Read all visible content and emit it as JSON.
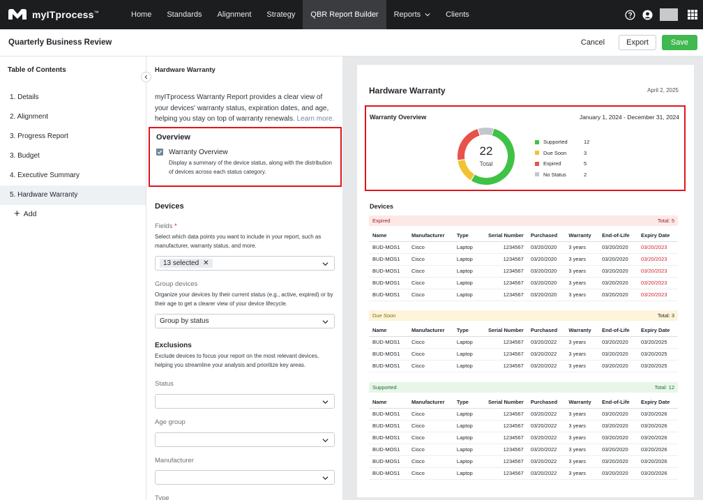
{
  "nav": {
    "brand": "myITprocess",
    "items": [
      {
        "label": "Home",
        "active": false
      },
      {
        "label": "Standards",
        "active": false
      },
      {
        "label": "Alignment",
        "active": false
      },
      {
        "label": "Strategy",
        "active": false
      },
      {
        "label": "QBR Report Builder",
        "active": true
      },
      {
        "label": "Reports",
        "active": false,
        "dropdown": true
      },
      {
        "label": "Clients",
        "active": false
      }
    ],
    "right_icons": [
      "help-icon",
      "user-icon",
      "apps-grid-icon"
    ]
  },
  "header": {
    "title": "Quarterly Business Review",
    "cancel_label": "Cancel",
    "export_label": "Export",
    "save_label": "Save"
  },
  "sidebar": {
    "title": "Table of Contents",
    "items": [
      {
        "label": "1. Details",
        "active": false
      },
      {
        "label": "2. Alignment",
        "active": false
      },
      {
        "label": "3. Progress Report",
        "active": false
      },
      {
        "label": "3. Budget",
        "active": false
      },
      {
        "label": "4. Executive Summary",
        "active": false
      },
      {
        "label": "5. Hardware Warranty",
        "active": true
      }
    ],
    "add_label": "Add"
  },
  "config": {
    "title": "Hardware Warranty",
    "description": "myITprocess Warranty Report provides a clear view of your devices' warranty status, expiration dates, and age, helping you stay on top of warranty renewals.",
    "learn_more": "Learn more.",
    "overview": {
      "heading": "Overview",
      "checkbox_label": "Warranty Overview",
      "checkbox_checked": true,
      "checkbox_desc": "Display a summary of the device status, along with the distribution of devices across each status category."
    },
    "devices_heading": "Devices",
    "fields": {
      "label": "Fields",
      "required_mark": "*",
      "help": "Select which data points you want to include in your report, such as manufacturer, warranty status, and more.",
      "chip": "13 selected"
    },
    "group_devices": {
      "label": "Group devices",
      "help": "Organize your devices by their current status (e.g., active, expired) or by their age to get a clearer view of your device lifecycle.",
      "value": "Group by status"
    },
    "exclusions": {
      "heading": "Exclusions",
      "help": "Exclude devices to focus your report on the most relevant devices, helping you streamline your analysis and prioritize key areas.",
      "status_label": "Status",
      "age_label": "Age group",
      "manufacturer_label": "Manufacturer",
      "type_label": "Type"
    }
  },
  "preview": {
    "title": "Hardware Warranty",
    "date": "April 2, 2025",
    "overview": {
      "title": "Warranty Overview",
      "range": "January 1, 2024 - December 31, 2024",
      "total": "22",
      "total_label": "Total",
      "legend": [
        {
          "name": "Supported",
          "value": "12",
          "color": "#3fc245"
        },
        {
          "name": "Due Soon",
          "value": "3",
          "color": "#f2c230"
        },
        {
          "name": "Expired",
          "value": "5",
          "color": "#e8524a"
        },
        {
          "name": "No Status",
          "value": "2",
          "color": "#c3c6ca"
        }
      ]
    },
    "devices_heading": "Devices",
    "columns": [
      "Name",
      "Manufacturer",
      "Type",
      "Serial Number",
      "Purchased",
      "Warranty",
      "End-of-Life",
      "Expiry Date"
    ],
    "groups": {
      "expired": {
        "label": "Expired",
        "total": "Total: 5",
        "rows": [
          [
            "BUD-MOS1",
            "Cisco",
            "Laptop",
            "1234567",
            "03/20/2020",
            "3 years",
            "03/20/2020",
            "03/20/2023"
          ],
          [
            "BUD-MOS1",
            "Cisco",
            "Laptop",
            "1234567",
            "03/20/2020",
            "3 years",
            "03/20/2020",
            "03/20/2023"
          ],
          [
            "BUD-MOS1",
            "Cisco",
            "Laptop",
            "1234567",
            "03/20/2020",
            "3 years",
            "03/20/2020",
            "03/20/2023"
          ],
          [
            "BUD-MOS1",
            "Cisco",
            "Laptop",
            "1234567",
            "03/20/2020",
            "3 years",
            "03/20/2020",
            "03/20/2023"
          ],
          [
            "BUD-MOS1",
            "Cisco",
            "Laptop",
            "1234567",
            "03/20/2020",
            "3 years",
            "03/20/2020",
            "03/20/2023"
          ]
        ]
      },
      "due": {
        "label": "Due Soon",
        "total": "Total: 3",
        "rows": [
          [
            "BUD-MOS1",
            "Cisco",
            "Laptop",
            "1234567",
            "03/20/2022",
            "3 years",
            "03/20/2020",
            "03/20/2025"
          ],
          [
            "BUD-MOS1",
            "Cisco",
            "Laptop",
            "1234567",
            "03/20/2022",
            "3 years",
            "03/20/2020",
            "03/20/2025"
          ],
          [
            "BUD-MOS1",
            "Cisco",
            "Laptop",
            "1234567",
            "03/20/2022",
            "3 years",
            "03/20/2020",
            "03/20/2025"
          ]
        ]
      },
      "supported": {
        "label": "Supported",
        "total": "Total: 12",
        "rows": [
          [
            "BUD-MOS1",
            "Cisco",
            "Laptop",
            "1234567",
            "03/20/2022",
            "3 years",
            "03/20/2020",
            "03/20/2026"
          ],
          [
            "BUD-MOS1",
            "Cisco",
            "Laptop",
            "1234567",
            "03/20/2022",
            "3 years",
            "03/20/2020",
            "03/20/2026"
          ],
          [
            "BUD-MOS1",
            "Cisco",
            "Laptop",
            "1234567",
            "03/20/2022",
            "3 years",
            "03/20/2020",
            "03/20/2026"
          ],
          [
            "BUD-MOS1",
            "Cisco",
            "Laptop",
            "1234567",
            "03/20/2022",
            "3 years",
            "03/20/2020",
            "03/20/2026"
          ],
          [
            "BUD-MOS1",
            "Cisco",
            "Laptop",
            "1234567",
            "03/20/2022",
            "3 years",
            "03/20/2020",
            "03/20/2026"
          ],
          [
            "BUD-MOS1",
            "Cisco",
            "Laptop",
            "1234567",
            "03/20/2022",
            "3 years",
            "03/20/2020",
            "03/20/2026"
          ]
        ]
      }
    }
  }
}
